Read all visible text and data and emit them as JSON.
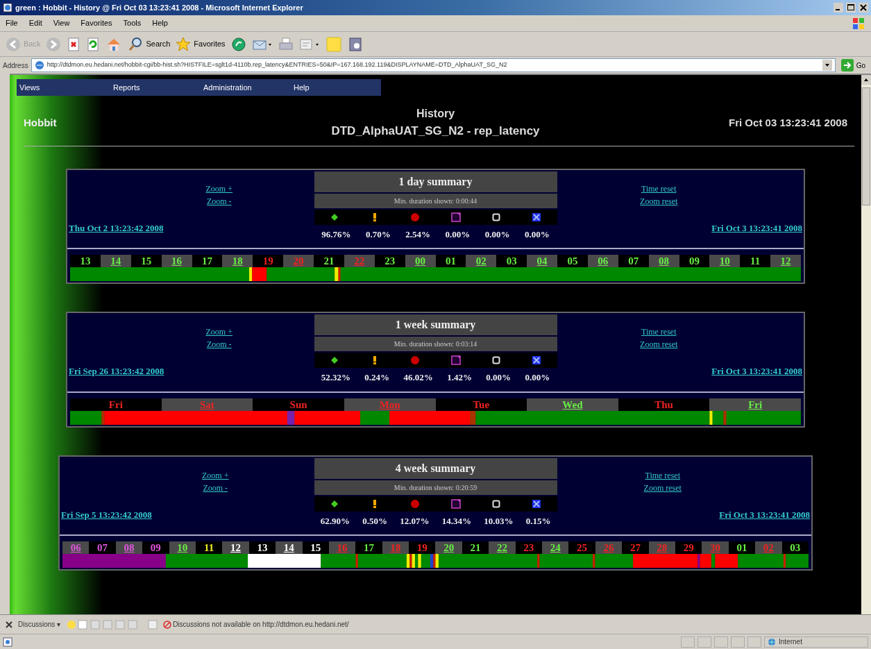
{
  "window": {
    "title": "green : Hobbit - History @ Fri Oct 03 13:23:41 2008 - Microsoft Internet Explorer"
  },
  "menu": [
    "File",
    "Edit",
    "View",
    "Favorites",
    "Tools",
    "Help"
  ],
  "toolbar": {
    "back": "Back",
    "search": "Search",
    "favorites": "Favorites"
  },
  "address": {
    "label": "Address",
    "url": "http://dtdmon.eu.hedani.net/hobbit-cgi/bb-hist.sh?HISTFILE=sglt1d-4110b.rep_latency&ENTRIES=50&IP=167.168.192.119&DISPLAYNAME=DTD_AlphaUAT_SG_N2",
    "go": "Go"
  },
  "nav": [
    "Views",
    "Reports",
    "Administration",
    "Help"
  ],
  "logo": "Hobbit",
  "heading": "History",
  "subheading": "DTD_AlphaUAT_SG_N2 - rep_latency",
  "datetime": "Fri Oct 03 13:23:41 2008",
  "summaries": [
    {
      "title": "1 day summary",
      "min_duration": "Min. duration shown: 0:00:44",
      "zoom_in": "Zoom +",
      "zoom_out": "Zoom -",
      "time_reset": "Time reset",
      "zoom_reset": "Zoom reset",
      "start": "Thu Oct 2 13:23:42 2008",
      "end": "Fri Oct 3 13:23:41 2008",
      "stats": [
        {
          "kind": "green",
          "value": "96.76%"
        },
        {
          "kind": "yellow",
          "value": "0.70%"
        },
        {
          "kind": "red",
          "value": "2.54%"
        },
        {
          "kind": "purple",
          "value": "0.00%"
        },
        {
          "kind": "clear",
          "value": "0.00%"
        },
        {
          "kind": "blue",
          "value": "0.00%"
        }
      ],
      "labels": [
        {
          "text": "13",
          "kind": "green",
          "shaded": false
        },
        {
          "text": "14",
          "kind": "green",
          "shaded": true
        },
        {
          "text": "15",
          "kind": "green",
          "shaded": false
        },
        {
          "text": "16",
          "kind": "green",
          "shaded": true
        },
        {
          "text": "17",
          "kind": "green",
          "shaded": false
        },
        {
          "text": "18",
          "kind": "green",
          "shaded": true
        },
        {
          "text": "19",
          "kind": "red",
          "shaded": false
        },
        {
          "text": "20",
          "kind": "red",
          "shaded": true
        },
        {
          "text": "21",
          "kind": "green",
          "shaded": false
        },
        {
          "text": "22",
          "kind": "red",
          "shaded": true
        },
        {
          "text": "23",
          "kind": "green",
          "shaded": false
        },
        {
          "text": "00",
          "kind": "green",
          "shaded": true
        },
        {
          "text": "01",
          "kind": "green",
          "shaded": false
        },
        {
          "text": "02",
          "kind": "green",
          "shaded": true
        },
        {
          "text": "03",
          "kind": "green",
          "shaded": false
        },
        {
          "text": "04",
          "kind": "green",
          "shaded": true
        },
        {
          "text": "05",
          "kind": "green",
          "shaded": false
        },
        {
          "text": "06",
          "kind": "green",
          "shaded": true
        },
        {
          "text": "07",
          "kind": "green",
          "shaded": false
        },
        {
          "text": "08",
          "kind": "green",
          "shaded": true
        },
        {
          "text": "09",
          "kind": "green",
          "shaded": false
        },
        {
          "text": "10",
          "kind": "green",
          "shaded": true
        },
        {
          "text": "11",
          "kind": "green",
          "shaded": false
        },
        {
          "text": "12",
          "kind": "green",
          "shaded": true
        }
      ]
    },
    {
      "title": "1 week summary",
      "min_duration": "Min. duration shown: 0:03:14",
      "zoom_in": "Zoom +",
      "zoom_out": "Zoom -",
      "time_reset": "Time reset",
      "zoom_reset": "Zoom reset",
      "start": "Fri Sep 26 13:23:42 2008",
      "end": "Fri Oct 3 13:23:41 2008",
      "stats": [
        {
          "kind": "green",
          "value": "52.32%"
        },
        {
          "kind": "yellow",
          "value": "0.24%"
        },
        {
          "kind": "red",
          "value": "46.02%"
        },
        {
          "kind": "purple",
          "value": "1.42%"
        },
        {
          "kind": "clear",
          "value": "0.00%"
        },
        {
          "kind": "blue",
          "value": "0.00%"
        }
      ],
      "labels": [
        {
          "text": "Fri",
          "kind": "red",
          "shaded": false
        },
        {
          "text": "Sat",
          "kind": "red",
          "shaded": true
        },
        {
          "text": "Sun",
          "kind": "red",
          "shaded": false
        },
        {
          "text": "Mon",
          "kind": "red",
          "shaded": true
        },
        {
          "text": "Tue",
          "kind": "red",
          "shaded": false
        },
        {
          "text": "Wed",
          "kind": "green",
          "shaded": true
        },
        {
          "text": "Thu",
          "kind": "red",
          "shaded": false
        },
        {
          "text": "Fri",
          "kind": "green",
          "shaded": true
        }
      ]
    },
    {
      "title": "4 week summary",
      "min_duration": "Min. duration shown: 0:20:59",
      "zoom_in": "Zoom +",
      "zoom_out": "Zoom -",
      "time_reset": "Time reset",
      "zoom_reset": "Zoom reset",
      "start": "Fri Sep 5 13:23:42 2008",
      "end": "Fri Oct 3 13:23:41 2008",
      "stats": [
        {
          "kind": "green",
          "value": "62.90%"
        },
        {
          "kind": "yellow",
          "value": "0.50%"
        },
        {
          "kind": "red",
          "value": "12.07%"
        },
        {
          "kind": "purple",
          "value": "14.34%"
        },
        {
          "kind": "clear",
          "value": "10.03%"
        },
        {
          "kind": "blue",
          "value": "0.15%"
        }
      ],
      "labels": [
        {
          "text": "06",
          "kind": "purple",
          "shaded": true
        },
        {
          "text": "07",
          "kind": "purple",
          "shaded": false
        },
        {
          "text": "08",
          "kind": "purple",
          "shaded": true
        },
        {
          "text": "09",
          "kind": "purple",
          "shaded": false
        },
        {
          "text": "10",
          "kind": "green",
          "shaded": true
        },
        {
          "text": "11",
          "kind": "yellow",
          "shaded": false
        },
        {
          "text": "12",
          "kind": "clear",
          "shaded": true
        },
        {
          "text": "13",
          "kind": "clear",
          "shaded": false
        },
        {
          "text": "14",
          "kind": "clear",
          "shaded": true
        },
        {
          "text": "15",
          "kind": "clear",
          "shaded": false
        },
        {
          "text": "16",
          "kind": "red",
          "shaded": true
        },
        {
          "text": "17",
          "kind": "green",
          "shaded": false
        },
        {
          "text": "18",
          "kind": "red",
          "shaded": true
        },
        {
          "text": "19",
          "kind": "red",
          "shaded": false
        },
        {
          "text": "20",
          "kind": "green",
          "shaded": true
        },
        {
          "text": "21",
          "kind": "green",
          "shaded": false
        },
        {
          "text": "22",
          "kind": "green",
          "shaded": true
        },
        {
          "text": "23",
          "kind": "red",
          "shaded": false
        },
        {
          "text": "24",
          "kind": "green",
          "shaded": true
        },
        {
          "text": "25",
          "kind": "red",
          "shaded": false
        },
        {
          "text": "26",
          "kind": "red",
          "shaded": true
        },
        {
          "text": "27",
          "kind": "red",
          "shaded": false
        },
        {
          "text": "28",
          "kind": "red",
          "shaded": true
        },
        {
          "text": "29",
          "kind": "red",
          "shaded": false
        },
        {
          "text": "30",
          "kind": "red",
          "shaded": true
        },
        {
          "text": "01",
          "kind": "green",
          "shaded": false
        },
        {
          "text": "02",
          "kind": "red",
          "shaded": true
        },
        {
          "text": "03",
          "kind": "green",
          "shaded": false
        }
      ]
    }
  ],
  "discussions": {
    "label": "Discussions ▾",
    "message": "Discussions not available on http://dtdmon.eu.hedani.net/"
  },
  "status_bar": {
    "zone": "Internet"
  }
}
